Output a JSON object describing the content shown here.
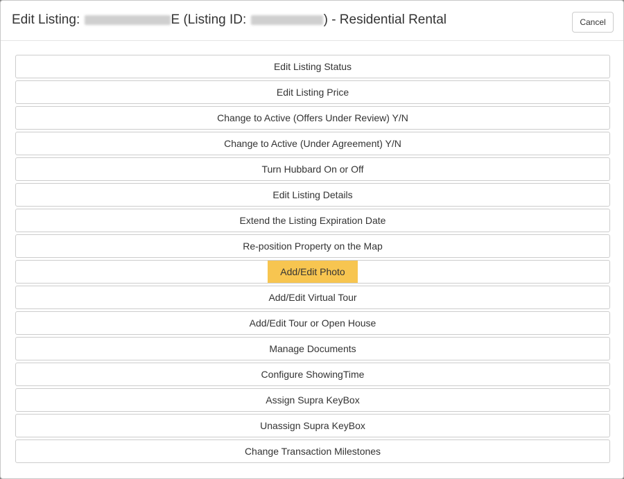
{
  "modal": {
    "title_prefix": "Edit Listing:",
    "title_address_tail": "E",
    "title_listing_open": "(Listing ID:",
    "title_listing_close": ")",
    "title_suffix": "- Residential Rental",
    "cancel_label": "Cancel"
  },
  "actions": [
    {
      "label": "Edit Listing Status"
    },
    {
      "label": "Edit Listing Price"
    },
    {
      "label": "Change to Active (Offers Under Review) Y/N"
    },
    {
      "label": "Change to Active (Under Agreement) Y/N"
    },
    {
      "label": "Turn Hubbard On or Off"
    },
    {
      "label": "Edit Listing Details"
    },
    {
      "label": "Extend the Listing Expiration Date"
    },
    {
      "label": "Re-position Property on the Map"
    },
    {
      "label": "Add/Edit Photo"
    },
    {
      "label": "Add/Edit Virtual Tour"
    },
    {
      "label": "Add/Edit Tour or Open House"
    },
    {
      "label": "Manage Documents"
    },
    {
      "label": "Configure ShowingTime"
    },
    {
      "label": "Assign Supra KeyBox"
    },
    {
      "label": "Unassign Supra KeyBox"
    },
    {
      "label": "Change Transaction Milestones"
    }
  ],
  "colors": {
    "highlight": "#f7c550",
    "border": "#cccccc",
    "text": "#333333"
  }
}
